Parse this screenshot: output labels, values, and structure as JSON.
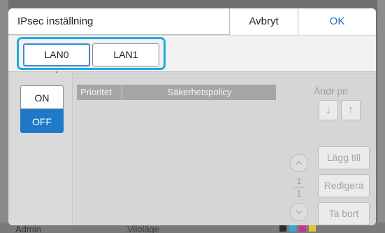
{
  "background": {
    "footer_left": "Admin",
    "footer_mid": "Viloläge"
  },
  "dialog": {
    "title": "IPsec inställning",
    "cancel_label": "Avbryt",
    "ok_label": "OK"
  },
  "lan_tabs": [
    {
      "label": "LAN0",
      "selected": true
    },
    {
      "label": "LAN1",
      "selected": false
    }
  ],
  "toggle": {
    "on_label": "ON",
    "off_label": "OFF",
    "selected": "OFF"
  },
  "policy_table": {
    "columns": [
      "Prioritet",
      "Säkerhetspolicy"
    ],
    "rows": []
  },
  "priority": {
    "label": "Ändr pri",
    "down_icon": "↓",
    "up_icon": "↑"
  },
  "pagination": {
    "current": "1",
    "total": "1"
  },
  "actions": {
    "add_label": "Lägg till",
    "edit_label": "Redigera",
    "delete_label": "Ta bort"
  },
  "colors": {
    "accent": "#1f78c8",
    "highlight": "#22a9df",
    "ok_text": "#1e6fd0"
  }
}
